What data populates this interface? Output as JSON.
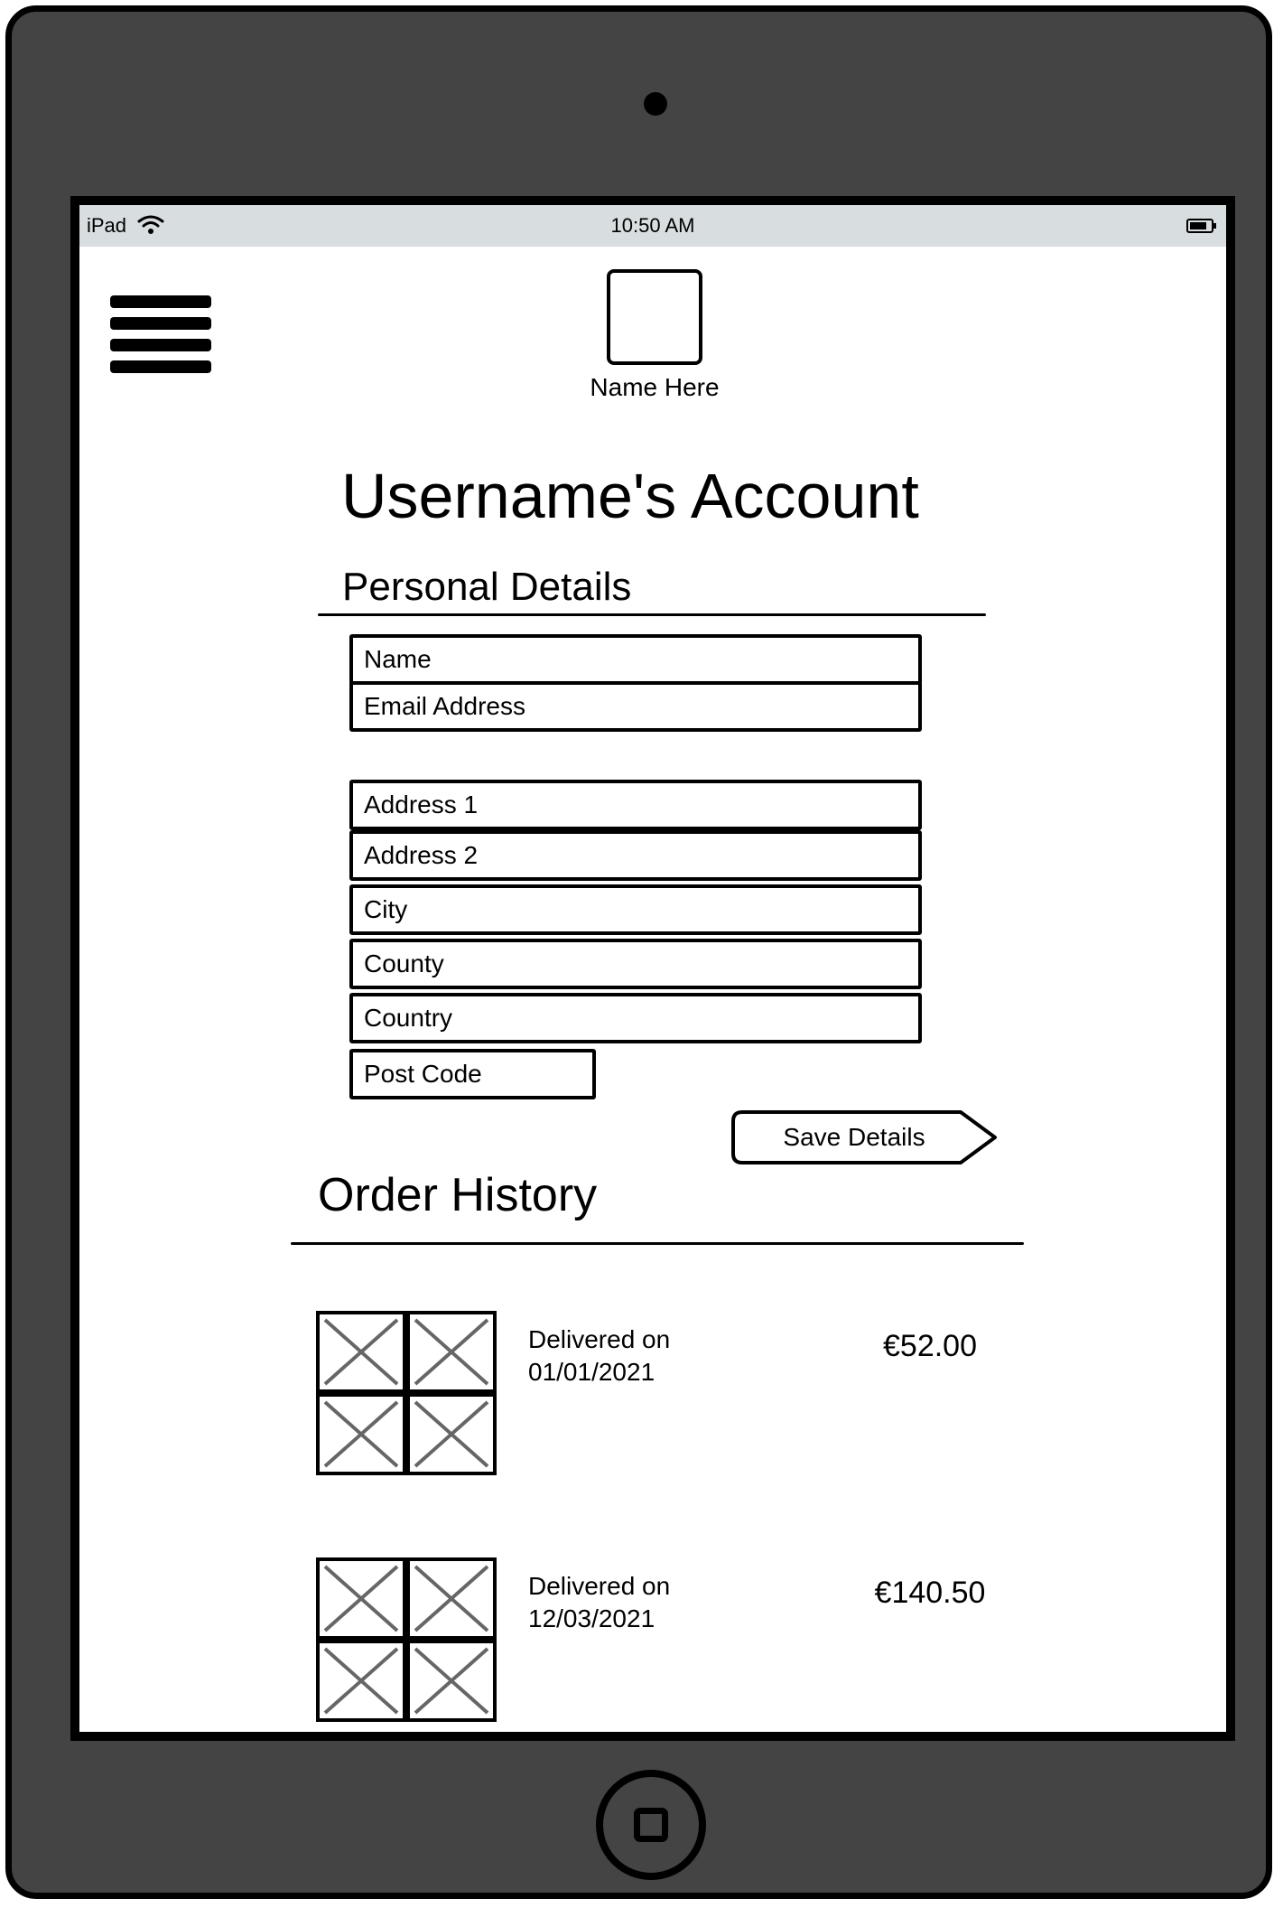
{
  "status_bar": {
    "device": "iPad",
    "time": "10:50 AM"
  },
  "header": {
    "logo_name": "Name Here"
  },
  "page": {
    "title": "Username's Account"
  },
  "personal_details": {
    "heading": "Personal Details",
    "fields": {
      "name": "Name",
      "email": "Email Address",
      "address1": "Address 1",
      "address2": "Address 2",
      "city": "City",
      "county": "County",
      "country": "Country",
      "post_code": "Post Code"
    },
    "save_label": "Save Details"
  },
  "order_history": {
    "heading": "Order History",
    "orders": [
      {
        "status": "Delivered on",
        "date": "01/01/2021",
        "price": "€52.00"
      },
      {
        "status": "Delivered on",
        "date": "12/03/2021",
        "price": "€140.50"
      }
    ]
  },
  "icons": {
    "menu": "hamburger-menu-icon",
    "wifi": "wifi-icon",
    "battery": "battery-icon",
    "camera": "camera-icon",
    "home": "home-button-icon",
    "product_image": "image-placeholder-icon"
  }
}
